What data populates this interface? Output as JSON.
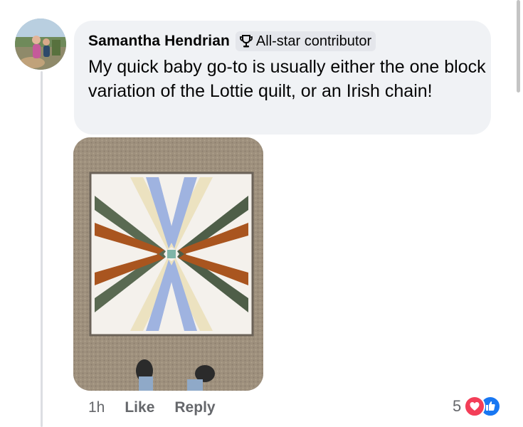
{
  "comment": {
    "author": "Samantha Hendrian",
    "badge": "All-star contributor",
    "text": "My quick baby go-to is usually either the one block variation of the Lottie quilt, or an Irish chain!",
    "timestamp": "1h",
    "like_label": "Like",
    "reply_label": "Reply",
    "reaction_count": "5",
    "reactions": [
      "love-icon",
      "like-icon"
    ]
  },
  "icons": {
    "badge": "trophy-icon"
  },
  "colors": {
    "bubble": "#f0f2f5",
    "secondary_text": "#65676b",
    "love": "#f33e58",
    "like": "#1877f2"
  }
}
